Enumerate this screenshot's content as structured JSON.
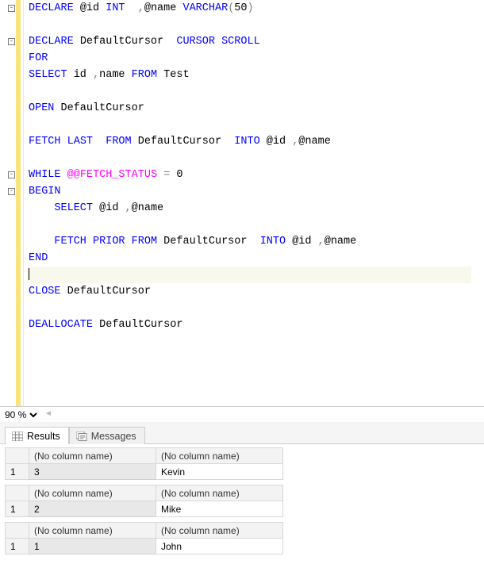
{
  "editor": {
    "lines": [
      [
        {
          "t": "DECLARE",
          "c": "kw"
        },
        {
          "t": " @id ",
          "c": "ident"
        },
        {
          "t": "INT",
          "c": "kw"
        },
        {
          "t": "  ",
          "c": "txt"
        },
        {
          "t": ",",
          "c": "gray"
        },
        {
          "t": "@name ",
          "c": "ident"
        },
        {
          "t": "VARCHAR",
          "c": "kw"
        },
        {
          "t": "(",
          "c": "gray"
        },
        {
          "t": "50",
          "c": "txt"
        },
        {
          "t": ")",
          "c": "gray"
        }
      ],
      [],
      [
        {
          "t": "DECLARE",
          "c": "kw"
        },
        {
          "t": " DefaultCursor  ",
          "c": "ident"
        },
        {
          "t": "CURSOR",
          "c": "kw"
        },
        {
          "t": " ",
          "c": "txt"
        },
        {
          "t": "SCROLL",
          "c": "kw"
        }
      ],
      [
        {
          "t": "FOR",
          "c": "kw"
        }
      ],
      [
        {
          "t": "SELECT",
          "c": "kw"
        },
        {
          "t": " id ",
          "c": "ident"
        },
        {
          "t": ",",
          "c": "gray"
        },
        {
          "t": "name ",
          "c": "ident"
        },
        {
          "t": "FROM",
          "c": "kw"
        },
        {
          "t": " Test",
          "c": "ident"
        }
      ],
      [],
      [
        {
          "t": "OPEN",
          "c": "kw"
        },
        {
          "t": " DefaultCursor",
          "c": "ident"
        }
      ],
      [],
      [
        {
          "t": "FETCH",
          "c": "kw"
        },
        {
          "t": " ",
          "c": "txt"
        },
        {
          "t": "LAST",
          "c": "kw"
        },
        {
          "t": "  ",
          "c": "txt"
        },
        {
          "t": "FROM",
          "c": "kw"
        },
        {
          "t": " DefaultCursor  ",
          "c": "ident"
        },
        {
          "t": "INTO",
          "c": "kw"
        },
        {
          "t": " @id ",
          "c": "ident"
        },
        {
          "t": ",",
          "c": "gray"
        },
        {
          "t": "@name",
          "c": "ident"
        }
      ],
      [],
      [
        {
          "t": "WHILE",
          "c": "kw"
        },
        {
          "t": " ",
          "c": "txt"
        },
        {
          "t": "@@FETCH_STATUS",
          "c": "sys"
        },
        {
          "t": " ",
          "c": "txt"
        },
        {
          "t": "=",
          "c": "gray"
        },
        {
          "t": " 0",
          "c": "txt"
        }
      ],
      [
        {
          "t": "BEGIN",
          "c": "kw"
        }
      ],
      [
        {
          "t": "    ",
          "c": "txt"
        },
        {
          "t": "SELECT",
          "c": "kw"
        },
        {
          "t": " @id ",
          "c": "ident"
        },
        {
          "t": ",",
          "c": "gray"
        },
        {
          "t": "@name",
          "c": "ident"
        }
      ],
      [],
      [
        {
          "t": "    ",
          "c": "txt"
        },
        {
          "t": "FETCH",
          "c": "kw"
        },
        {
          "t": " ",
          "c": "txt"
        },
        {
          "t": "PRIOR",
          "c": "kw"
        },
        {
          "t": " ",
          "c": "txt"
        },
        {
          "t": "FROM",
          "c": "kw"
        },
        {
          "t": " DefaultCursor  ",
          "c": "ident"
        },
        {
          "t": "INTO",
          "c": "kw"
        },
        {
          "t": " @id ",
          "c": "ident"
        },
        {
          "t": ",",
          "c": "gray"
        },
        {
          "t": "@name",
          "c": "ident"
        }
      ],
      [
        {
          "t": "END",
          "c": "kw"
        }
      ],
      [],
      [
        {
          "t": "CLOSE",
          "c": "kw"
        },
        {
          "t": " DefaultCursor",
          "c": "ident"
        }
      ],
      [],
      [
        {
          "t": "DEALLOCATE",
          "c": "kw"
        },
        {
          "t": " DefaultCursor",
          "c": "ident"
        }
      ]
    ],
    "fold_marks": [
      0,
      2,
      10,
      11
    ],
    "current_line_index": 16
  },
  "zoom": {
    "value": "90 %"
  },
  "tabs": {
    "results": "Results",
    "messages": "Messages",
    "active": "results"
  },
  "results": {
    "col_header": "(No column name)",
    "grids": [
      {
        "rownum": "1",
        "c1": "3",
        "c2": "Kevin"
      },
      {
        "rownum": "1",
        "c1": "2",
        "c2": "Mike"
      },
      {
        "rownum": "1",
        "c1": "1",
        "c2": "John"
      }
    ]
  }
}
